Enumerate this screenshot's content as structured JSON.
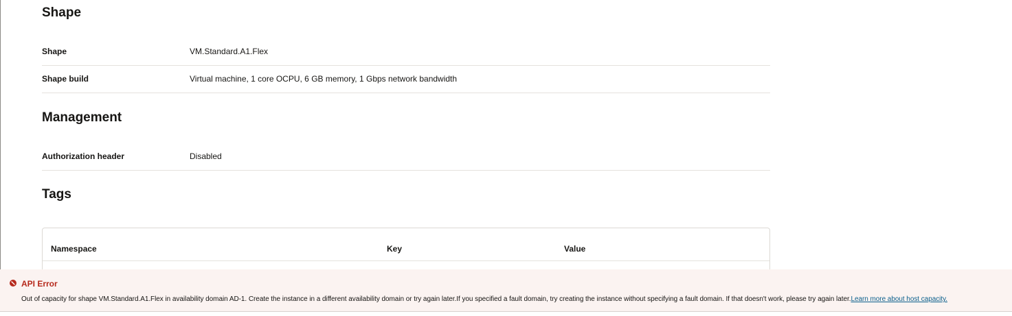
{
  "sections": {
    "shape": {
      "title": "Shape",
      "rows": [
        {
          "label": "Shape",
          "value": "VM.Standard.A1.Flex"
        },
        {
          "label": "Shape build",
          "value": "Virtual machine, 1 core OCPU, 6 GB memory, 1 Gbps network bandwidth"
        }
      ]
    },
    "management": {
      "title": "Management",
      "rows": [
        {
          "label": "Authorization header",
          "value": "Disabled"
        }
      ]
    },
    "tags": {
      "title": "Tags",
      "columns": [
        "Namespace",
        "Key",
        "Value"
      ]
    }
  },
  "error": {
    "title": "API Error",
    "message": "Out of capacity for shape VM.Standard.A1.Flex in availability domain AD-1. Create the instance in a different availability domain or try again later.If you specified a fault domain, try creating the instance without specifying a fault domain. If that doesn't work, please try again later.",
    "link_text": "Learn more about host capacity.",
    "icon": "error-circle-icon",
    "color": "#b6291c"
  },
  "colors": {
    "error_bg": "#fbf3f1",
    "link": "#0a5f8c",
    "text": "#161513"
  }
}
